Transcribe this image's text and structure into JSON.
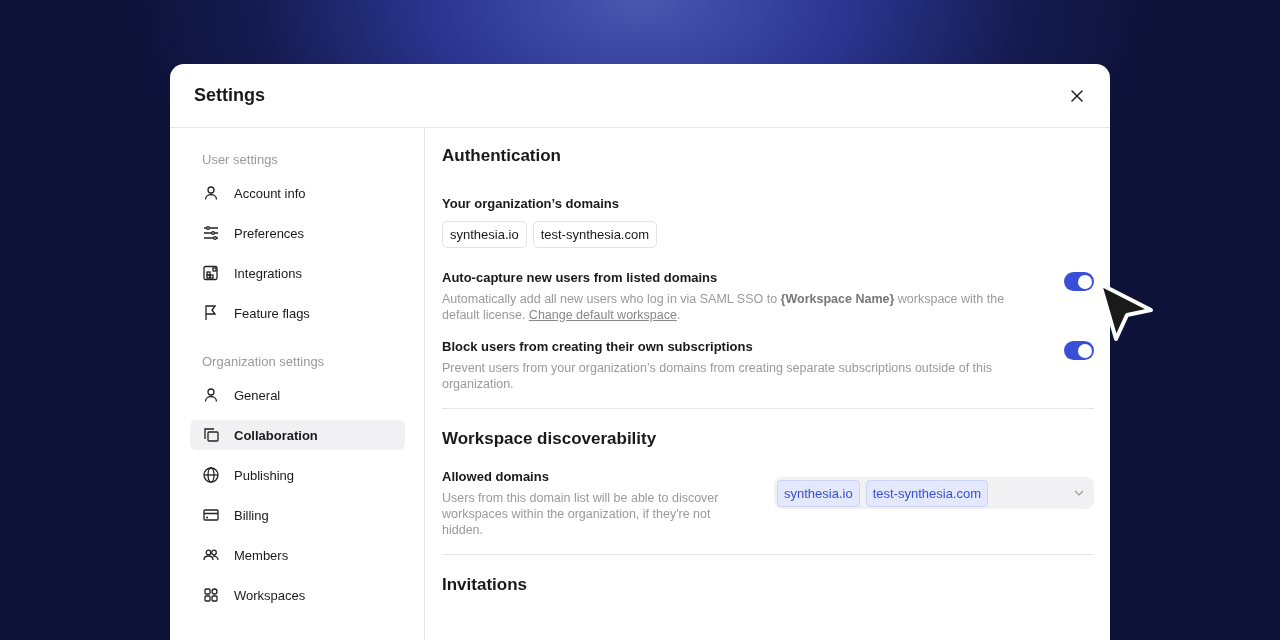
{
  "window": {
    "title": "Settings"
  },
  "sidebar": {
    "sections": [
      {
        "label": "User settings",
        "items": [
          {
            "label": "Account info",
            "selected": false
          },
          {
            "label": "Preferences",
            "selected": false
          },
          {
            "label": "Integrations",
            "selected": false
          },
          {
            "label": "Feature flags",
            "selected": false
          }
        ]
      },
      {
        "label": "Organization settings",
        "items": [
          {
            "label": "General",
            "selected": false
          },
          {
            "label": "Collaboration",
            "selected": true
          },
          {
            "label": "Publishing",
            "selected": false
          },
          {
            "label": "Billing",
            "selected": false
          },
          {
            "label": "Members",
            "selected": false
          },
          {
            "label": "Workspaces",
            "selected": false
          }
        ]
      }
    ]
  },
  "authentication": {
    "title": "Authentication",
    "domains_label": "Your organization’s domains",
    "domains": [
      "synthesia.io",
      "test-synthesia.com"
    ],
    "toggles": [
      {
        "label": "Auto-capture new users from listed domains",
        "description": "Automatically add all new users who log in via SAML SSO to **{Workspace Name}** workspace with the default license. ",
        "link": "Change default workspace",
        "after": ".",
        "on": true
      },
      {
        "label": "Block users from creating their own subscriptions",
        "description": "Prevent users from your organization’s domains from creating separate subscriptions outside of this organization.",
        "on": true
      }
    ]
  },
  "discoverability": {
    "title": "Workspace discoverability",
    "label": "Allowed domains",
    "description": "Users from this domain list will be able to discover workspaces within the organization, if they're not hidden.",
    "selected_domains": [
      "synthesia.io",
      "test-synthesia.com"
    ]
  },
  "invitations": {
    "title": "Invitations"
  }
}
